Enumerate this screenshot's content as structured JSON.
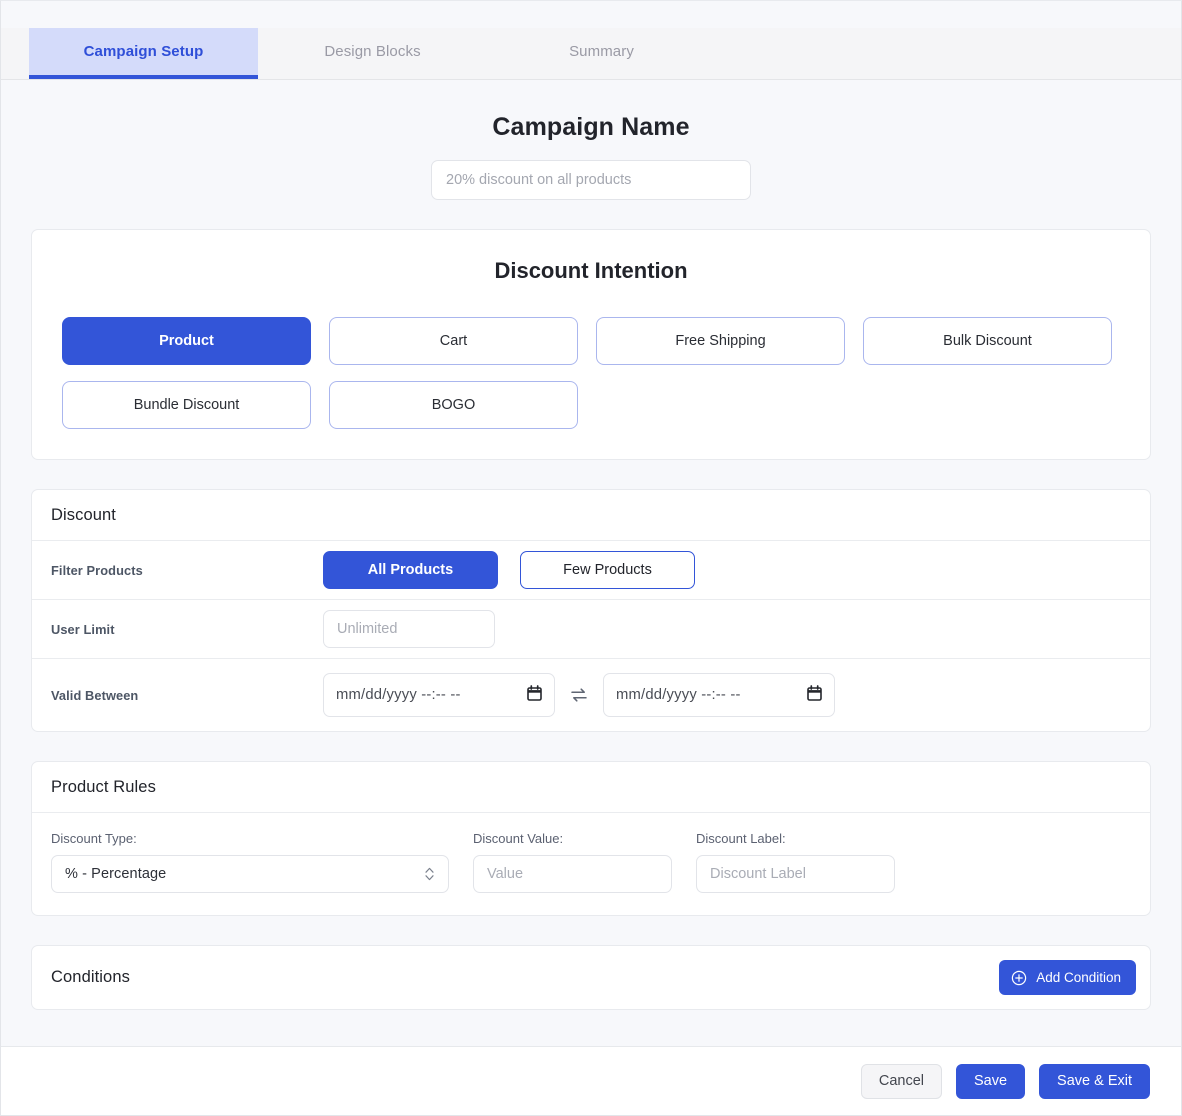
{
  "tabs": [
    {
      "label": "Campaign Setup",
      "active": true
    },
    {
      "label": "Design Blocks",
      "active": false
    },
    {
      "label": "Summary",
      "active": false
    }
  ],
  "campaign": {
    "title": "Campaign Name",
    "name_value": "",
    "name_placeholder": "20% discount on all products"
  },
  "intention": {
    "title": "Discount Intention",
    "options": [
      {
        "label": "Product",
        "selected": true
      },
      {
        "label": "Cart",
        "selected": false
      },
      {
        "label": "Free Shipping",
        "selected": false
      },
      {
        "label": "Bulk Discount",
        "selected": false
      },
      {
        "label": "Bundle Discount",
        "selected": false
      },
      {
        "label": "BOGO",
        "selected": false
      }
    ]
  },
  "discount": {
    "title": "Discount",
    "filter_products": {
      "label": "Filter Products",
      "options": [
        {
          "label": "All Products",
          "selected": true
        },
        {
          "label": "Few Products",
          "selected": false
        }
      ]
    },
    "user_limit": {
      "label": "User Limit",
      "value": "",
      "placeholder": "Unlimited"
    },
    "valid_between": {
      "label": "Valid Between",
      "start_placeholder": "mm/dd/yyyy --:-- --",
      "end_placeholder": "mm/dd/yyyy --:-- --",
      "swap_icon": "swap-arrows-icon",
      "calendar_icon": "calendar-icon"
    }
  },
  "product_rules": {
    "title": "Product Rules",
    "discount_type": {
      "label": "Discount Type:",
      "selected": "% - Percentage"
    },
    "discount_value": {
      "label": "Discount Value:",
      "value": "",
      "placeholder": "Value"
    },
    "discount_label": {
      "label": "Discount Label:",
      "value": "",
      "placeholder": "Discount Label"
    }
  },
  "conditions": {
    "title": "Conditions",
    "add_button": "Add Condition",
    "add_icon": "plus-circle-icon"
  },
  "footer": {
    "cancel": "Cancel",
    "save": "Save",
    "save_exit": "Save & Exit"
  },
  "colors": {
    "accent": "#3355d8",
    "accent_soft": "#d4dbfa",
    "page_bg": "#f7f8fb",
    "card_bg": "#ffffff",
    "border": "#e8eaee",
    "muted_text": "#9a9aa5"
  }
}
